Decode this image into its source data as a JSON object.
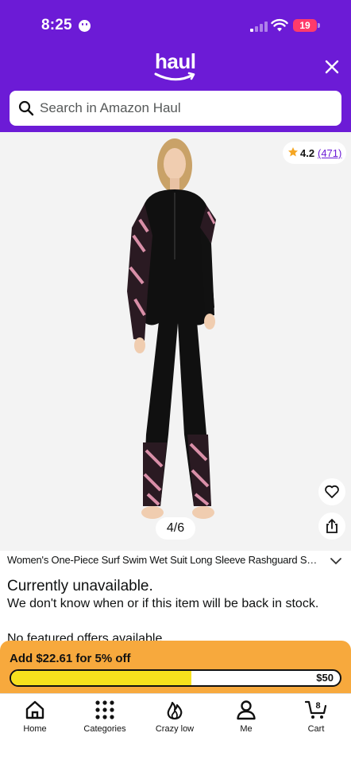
{
  "status_bar": {
    "time": "8:25",
    "battery": "19"
  },
  "header": {
    "logo_text": "haul",
    "close_icon": "close-icon"
  },
  "search": {
    "placeholder": "Search in Amazon Haul"
  },
  "product": {
    "rating": "4.2",
    "rating_count": "(471)",
    "image_counter": "4/6",
    "title": "Women's One-Piece Surf Swim Wet Suit Long Sleeve Rashguard Sun P...",
    "availability_heading": "Currently unavailable.",
    "availability_desc": "We don't know when or if this item will be back in stock.",
    "offers_text": "No featured offers available"
  },
  "promo": {
    "message": "Add $22.61 for 5% off",
    "goal_label": "$50",
    "progress_fraction": 0.548
  },
  "bottom_nav": {
    "items": [
      {
        "label": "Home",
        "icon": "home-icon"
      },
      {
        "label": "Categories",
        "icon": "grid-icon"
      },
      {
        "label": "Crazy low",
        "icon": "flame-icon"
      },
      {
        "label": "Me",
        "icon": "person-icon"
      },
      {
        "label": "Cart",
        "icon": "cart-icon",
        "badge": "8"
      }
    ]
  },
  "colors": {
    "brand_purple": "#6c1bd6",
    "promo_orange": "#f7a93d",
    "progress_yellow": "#f7e11d"
  }
}
